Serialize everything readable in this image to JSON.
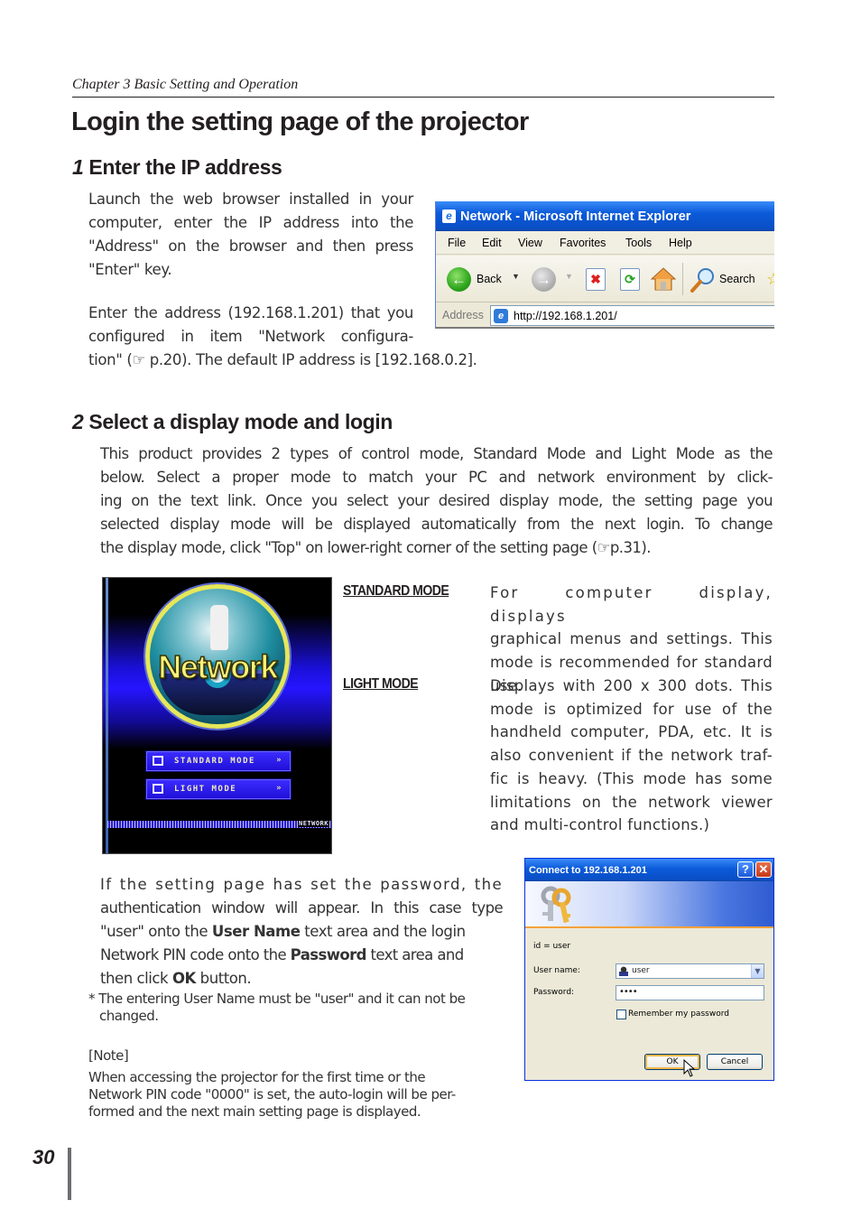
{
  "header": {
    "chapter": "Chapter 3 Basic Setting and Operation",
    "title": "Login the setting page of the projector"
  },
  "step1": {
    "number": "1",
    "heading": "Enter the IP address",
    "para1_lines": [
      "Launch the web browser installed in your",
      "computer, enter the IP address into the",
      "\"Address\" on the browser and then press",
      "\"Enter\" key."
    ],
    "para2_lines": [
      "Enter the address (192.168.1.201) that you",
      "configured in item \"Network configura-",
      "tion\" (☞ p.20). The default IP address is [192.168.0.2]."
    ]
  },
  "browser": {
    "title": "Network - Microsoft Internet Explorer",
    "menu": [
      "File",
      "Edit",
      "View",
      "Favorites",
      "Tools",
      "Help"
    ],
    "toolbar": {
      "back_label": "Back",
      "search_label": "Search"
    },
    "address_label": "Address",
    "address_value": "http://192.168.1.201/"
  },
  "step2": {
    "number": "2",
    "heading": "Select a display mode and login",
    "para_lines": [
      "This product provides 2 types of control mode, Standard Mode and Light Mode as the",
      "below. Select a proper mode to match your PC and network environment by click-",
      "ing on the text link. Once you select your desired display mode, the setting page you",
      "selected display mode will be displayed automatically from the next login. To change",
      "the display mode, click \"Top\" on lower-right corner of the setting page (☞p.31)."
    ]
  },
  "splash": {
    "logo_text": "Network",
    "buttons": [
      {
        "label": "STANDARD MODE",
        "arrow": "»"
      },
      {
        "label": "LIGHT MODE",
        "arrow": "»"
      }
    ],
    "footer_label": "NETWORK"
  },
  "modes": [
    {
      "link": "STANDARD MODE",
      "desc_lines": [
        "For computer display, displays",
        "graphical menus and settings. This",
        "mode is recommended for standard",
        "use."
      ]
    },
    {
      "link": "LIGHT MODE",
      "desc_lines": [
        "Displays with 200 x 300 dots. This",
        "mode is optimized for use of the",
        "handheld computer, PDA, etc. It is",
        "also convenient if the network traf-",
        "fic is heavy. (This mode has some",
        "limitations on the network viewer",
        "and multi-control functions.)"
      ]
    }
  ],
  "auth": {
    "line1": "If the setting page has set the password, the",
    "line2": "authentication window will appear. In this case type",
    "line3_a": "\"user\" onto the ",
    "line3_b": "User Name",
    "line3_c": " text area and the login",
    "line4_a": "Network PIN code onto the ",
    "line4_b": "Password",
    "line4_c": " text area and",
    "line5_a": "then click ",
    "line5_b": "OK",
    "line5_c": " button.",
    "footnote_line1": "* The entering User Name must be \"user\" and it can not be",
    "footnote_line2": "changed."
  },
  "dialog": {
    "title": "Connect to 192.168.1.201",
    "help": "?",
    "close": "✕",
    "realm": "id = user",
    "username_label": "User name:",
    "username_value": "user",
    "password_label": "Password:",
    "password_value": "••••",
    "remember_label": "Remember my password",
    "ok_label": "OK",
    "cancel_label": "Cancel"
  },
  "note": {
    "heading": "[Note]",
    "lines": [
      "When accessing the projector for the first time or the",
      "Network PIN code \"0000\" is set, the auto-login will be per-",
      "formed and the next main setting page is displayed."
    ]
  },
  "page_number": "30"
}
